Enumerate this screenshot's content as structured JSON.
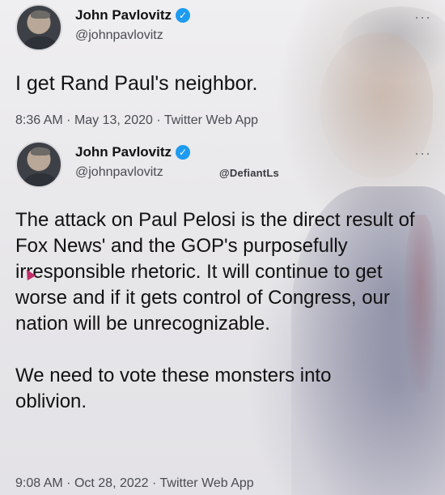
{
  "tweets": [
    {
      "author_name": "John Pavlovitz",
      "handle": "@johnpavlovitz",
      "text": "I get Rand Paul's neighbor.",
      "time": "8:36 AM",
      "date": "May 13, 2020",
      "source": "Twitter Web App"
    },
    {
      "author_name": "John Pavlovitz",
      "handle": "@johnpavlovitz",
      "paragraphs": [
        "The attack on Paul Pelosi is the direct result of Fox News' and the GOP's purposefully irresponsible rhetoric. It will continue to get worse and if it gets control of Congress, our nation will be unrecognizable.",
        "We need to vote these monsters into oblivion."
      ],
      "time": "9:08 AM",
      "date": "Oct 28, 2022",
      "source": "Twitter Web App"
    }
  ],
  "separator": "·",
  "more_icon": "···",
  "verified_icon": "✓",
  "watermark": "@DefiantLs",
  "colors": {
    "verified": "#1d9bf0",
    "text": "#111111",
    "secondary": "#4a4d52"
  }
}
